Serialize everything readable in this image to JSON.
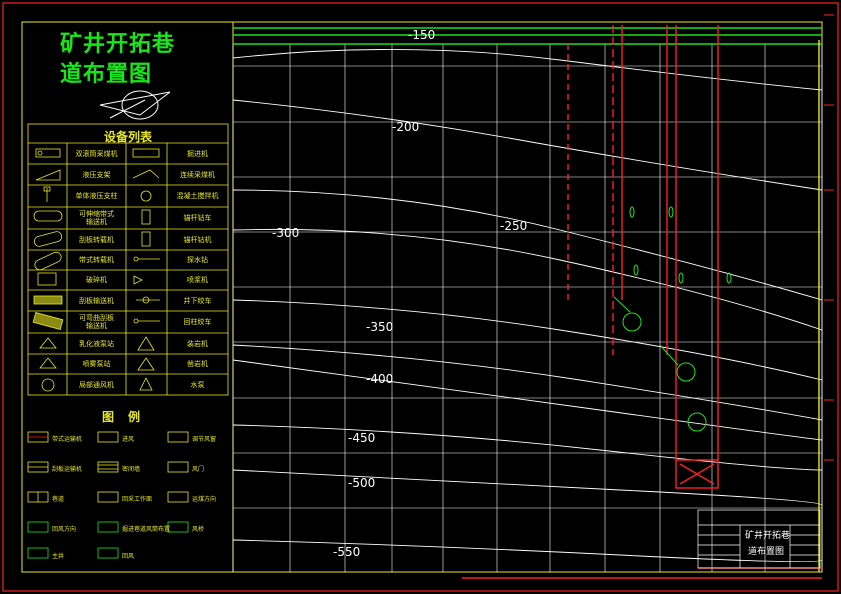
{
  "title": {
    "line1": "矿井开拓巷",
    "line2": "道布置图"
  },
  "equipment_table": {
    "heading": "设备列表",
    "rows": [
      {
        "left": "双滚筒采煤机",
        "right": "掘进机"
      },
      {
        "left": "液压支架",
        "right": "连续采煤机"
      },
      {
        "left": "单体液压支柱",
        "right": "混凝土搅拌机"
      },
      {
        "left": "可伸缩带式\n输送机",
        "right": "锚杆钻车"
      },
      {
        "left": "刮板转载机",
        "right": "锚杆钻机"
      },
      {
        "left": "带式转载机",
        "right": "探水钻"
      },
      {
        "left": "破碎机",
        "right": "喷浆机"
      },
      {
        "left": "刮板输送机",
        "right": "井下绞车"
      },
      {
        "left": "可弯曲刮板\n输送机",
        "right": "回柱绞车"
      },
      {
        "left": "乳化液泵站",
        "right": "装岩机"
      },
      {
        "left": "喷雾泵站",
        "right": "凿岩机"
      },
      {
        "left": "局部通风机",
        "right": "水泵"
      }
    ]
  },
  "legend": {
    "heading": "图例",
    "items": [
      {
        "label": "带式运输机"
      },
      {
        "label": "进风"
      },
      {
        "label": "调节风窗"
      },
      {
        "label": "刮板运输机"
      },
      {
        "label": "密闭墙"
      },
      {
        "label": "风门"
      },
      {
        "label": "巷道"
      },
      {
        "label": "回采工作面"
      },
      {
        "label": "运煤方向"
      },
      {
        "label": "回风方向"
      },
      {
        "label": "掘进巷道风筒布置"
      },
      {
        "label": "风桥"
      },
      {
        "label": "主井"
      },
      {
        "label": "回风"
      }
    ]
  },
  "contours": {
    "labels": [
      "-150",
      "-200",
      "-250",
      "-300",
      "-350",
      "-400",
      "-450",
      "-500",
      "-550"
    ]
  },
  "title_block": {
    "name_line1": "矿井开拓巷",
    "name_line2": "道布置图"
  },
  "colors": {
    "frame": "#e8e820",
    "title": "#19e619",
    "grid": "#ffffff",
    "accent_red": "#ff2020",
    "green": "#19e619",
    "background": "#000000"
  }
}
